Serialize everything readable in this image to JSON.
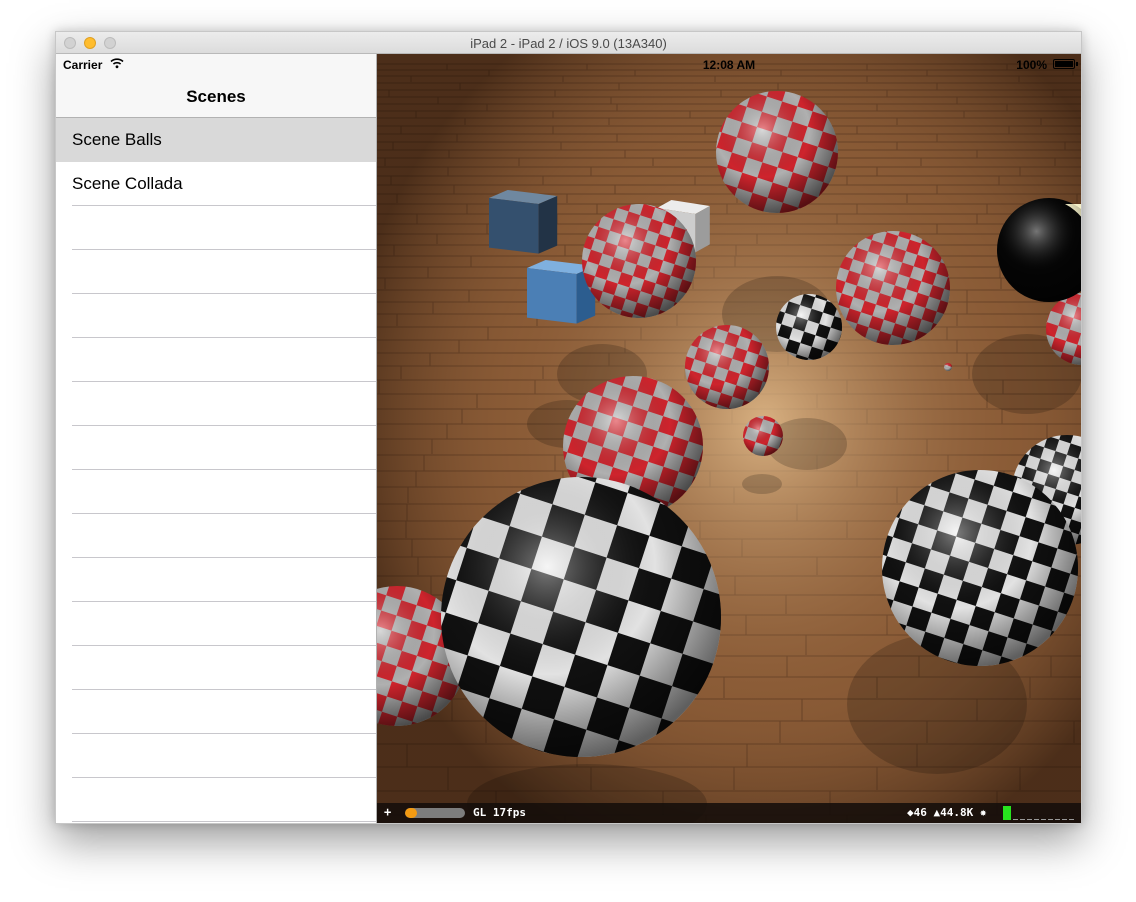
{
  "window": {
    "title": "iPad 2 - iPad 2 / iOS 9.0 (13A340)"
  },
  "statusbar": {
    "carrier": "Carrier",
    "time": "12:08 AM",
    "battery": "100%"
  },
  "master": {
    "title": "Scenes",
    "selected_index": 0,
    "items": [
      {
        "label": "Scene Balls"
      },
      {
        "label": "Scene Collada"
      }
    ]
  },
  "stats": {
    "toggle": "+",
    "renderer": "GL 17fps",
    "counts": "◆46 ▲44.8K ✸",
    "progress": 0.2
  },
  "colors": {
    "checker_red": "#d9262f",
    "checker_gray": "#b9b9b9",
    "checker_black": "#111111",
    "checker_white": "#eeeeee",
    "floor": "#8a5b36",
    "gauge_green": "#27e51e",
    "progress_orange": "#f39a12"
  }
}
